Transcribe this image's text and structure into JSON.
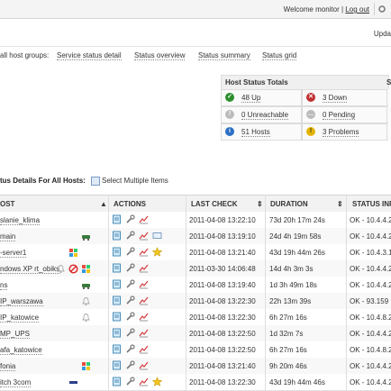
{
  "header": {
    "welcome": "Welcome monitor |",
    "logout": "Log out",
    "update": "Upda"
  },
  "nav": {
    "host_groups": "all host groups:",
    "service_status_detail": "Service status detail",
    "status_overview": "Status overview",
    "status_summary": "Status summary",
    "status_grid": "Status grid"
  },
  "totals": {
    "title": "Host Status Totals",
    "next_title_fragment": "S",
    "up": "48 Up",
    "down": "3 Down",
    "unreachable": "0 Unreachable",
    "pending": "0 Pending",
    "hosts": "51 Hosts",
    "problems": "3 Problems"
  },
  "details": {
    "title": "tus Details For All Hosts:",
    "select_multiple": "Select Multiple Items"
  },
  "columns": {
    "host": "OST",
    "actions": "ACTIONS",
    "last_check": "LAST CHECK",
    "duration": "DURATION",
    "status_info": "STATUS INF"
  },
  "rows": [
    {
      "host": "slanie_klima",
      "last_check": "2011-04-08 13:22:10",
      "duration": "73d 20h 17m 24s",
      "status": "OK - 10.4.4.2"
    },
    {
      "host": "main",
      "last_check": "2011-04-08 13:19:10",
      "duration": "24d 4h 19m 58s",
      "status": "OK - 10.4.4.2"
    },
    {
      "host": "-server1",
      "last_check": "2011-04-08 13:21:40",
      "duration": "43d 19h 44m 26s",
      "status": "OK - 10.4.3.1"
    },
    {
      "host": "ndows XP rt_obiks",
      "last_check": "2011-03-30 14:06:48",
      "duration": "14d 4h 3m 3s",
      "status": "OK - 10.4.4.2"
    },
    {
      "host": "ns",
      "last_check": "2011-04-08 13:19:40",
      "duration": "1d 3h 49m 18s",
      "status": "OK - 10.4.4.2"
    },
    {
      "host": "IP_warszawa",
      "last_check": "2011-04-08 13:22:30",
      "duration": "22h 13m 39s",
      "status": "OK - 93.159"
    },
    {
      "host": "IP_katowice",
      "last_check": "2011-04-08 13:22:30",
      "duration": "6h 27m 16s",
      "status": "OK - 10.4.8.2"
    },
    {
      "host": "MP_UPS",
      "last_check": "2011-04-08 13:22:50",
      "duration": "1d 32m 7s",
      "status": "OK - 10.4.4.2"
    },
    {
      "host": "afa_katowice",
      "last_check": "2011-04-08 13:22:50",
      "duration": "6h 27m 16s",
      "status": "OK - 10.4.8.2"
    },
    {
      "host": "fonia",
      "last_check": "2011-04-08 13:21:40",
      "duration": "9h 20m 46s",
      "status": "OK - 10.4.4.2"
    },
    {
      "host": "itch 3com",
      "last_check": "2011-04-08 13:22:30",
      "duration": "43d 19h 44m 46s",
      "status": "OK - 10.4.4.2"
    }
  ],
  "colors": {
    "up": "#2c8f2c",
    "down": "#c03030",
    "unreachable": "#bbbbbb",
    "pending": "#bbbbbb",
    "hosts": "#2a6fc4",
    "problems": "#e3b400"
  }
}
